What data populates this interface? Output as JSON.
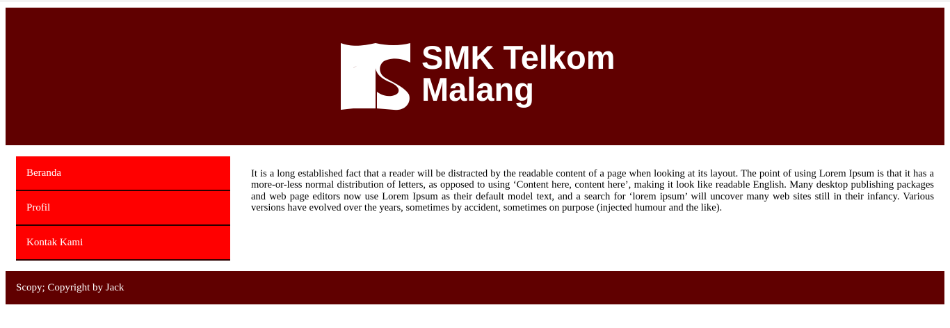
{
  "colors": {
    "header_bg": "#600000",
    "nav_bg": "#ff0000",
    "footer_bg": "#600000",
    "text_on_dark": "#ffffff"
  },
  "header": {
    "logo_icon": "telkom-ts-logo-icon",
    "title_line1": "SMK Telkom",
    "title_line2": "Malang"
  },
  "sidebar": {
    "items": [
      {
        "label": "Beranda"
      },
      {
        "label": "Profil"
      },
      {
        "label": "Kontak Kami"
      }
    ]
  },
  "main": {
    "paragraph": "It is a long established fact that a reader will be distracted by the readable content of a page when looking at its layout. The point of using Lorem Ipsum is that it has a more-or-less normal distribution of letters, as opposed to using ‘Content here, content here’, making it look like readable English. Many desktop publishing packages and web page editors now use Lorem Ipsum as their default model text, and a search for ‘lorem ipsum’ will uncover many web sites still in their infancy. Various versions have evolved over the years, sometimes by accident, sometimes on purpose (injected humour and the like)."
  },
  "footer": {
    "text": "Scopy; Copyright by Jack"
  }
}
